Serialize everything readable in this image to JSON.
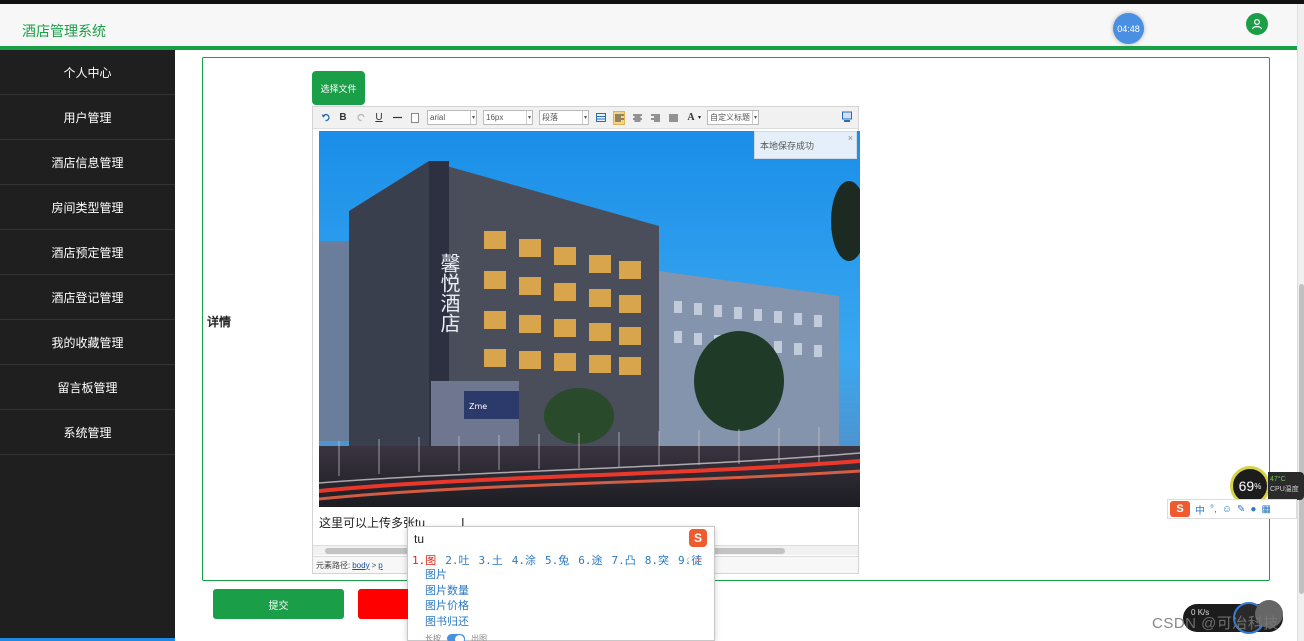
{
  "header": {
    "app_title": "酒店管理系统",
    "clock": "04:48"
  },
  "sidebar": {
    "items": [
      {
        "label": "个人中心"
      },
      {
        "label": "用户管理"
      },
      {
        "label": "酒店信息管理"
      },
      {
        "label": "房间类型管理"
      },
      {
        "label": "酒店预定管理"
      },
      {
        "label": "酒店登记管理"
      },
      {
        "label": "我的收藏管理"
      },
      {
        "label": "留言板管理"
      },
      {
        "label": "系统管理"
      }
    ]
  },
  "form": {
    "detail_label": "详情",
    "file_button": "选择文件",
    "submit_label": "提交"
  },
  "editor": {
    "font_family": "arial",
    "font_size": "16px",
    "paragraph": "段落",
    "custom_title": "自定义标题",
    "toast": "本地保存成功",
    "photo_sign": "馨悦酒店",
    "photo_sign_small": "Zme",
    "content_prefix": "这里可以上传多张",
    "content_typed": "tu",
    "path_label": "元素路径:",
    "path_body": "body",
    "path_sep": ">",
    "path_p": "p"
  },
  "ime": {
    "input": "tu",
    "candidates": [
      "1.图",
      "2.吐",
      "3.土",
      "4.涂",
      "5.兔",
      "6.途",
      "7.凸",
      "8.突",
      "9.徒"
    ],
    "suggestions": [
      "图片",
      "图片数量",
      "图片价格",
      "图书归还"
    ],
    "footer_label": "长按",
    "footer_label2": "出图"
  },
  "widgets": {
    "cpu_percent": "69",
    "cpu_unit": "%",
    "cpu_temp": "47°C",
    "cpu_label": "CPU温度",
    "ime_bar_zh": "中",
    "net_text": "0",
    "net_unit": "K/s",
    "watermark": "CSDN @可冶科技"
  },
  "colors": {
    "brand_green": "#1a9f48",
    "sidebar_bg": "#1f1f1f",
    "reset_red": "#ff0000"
  }
}
